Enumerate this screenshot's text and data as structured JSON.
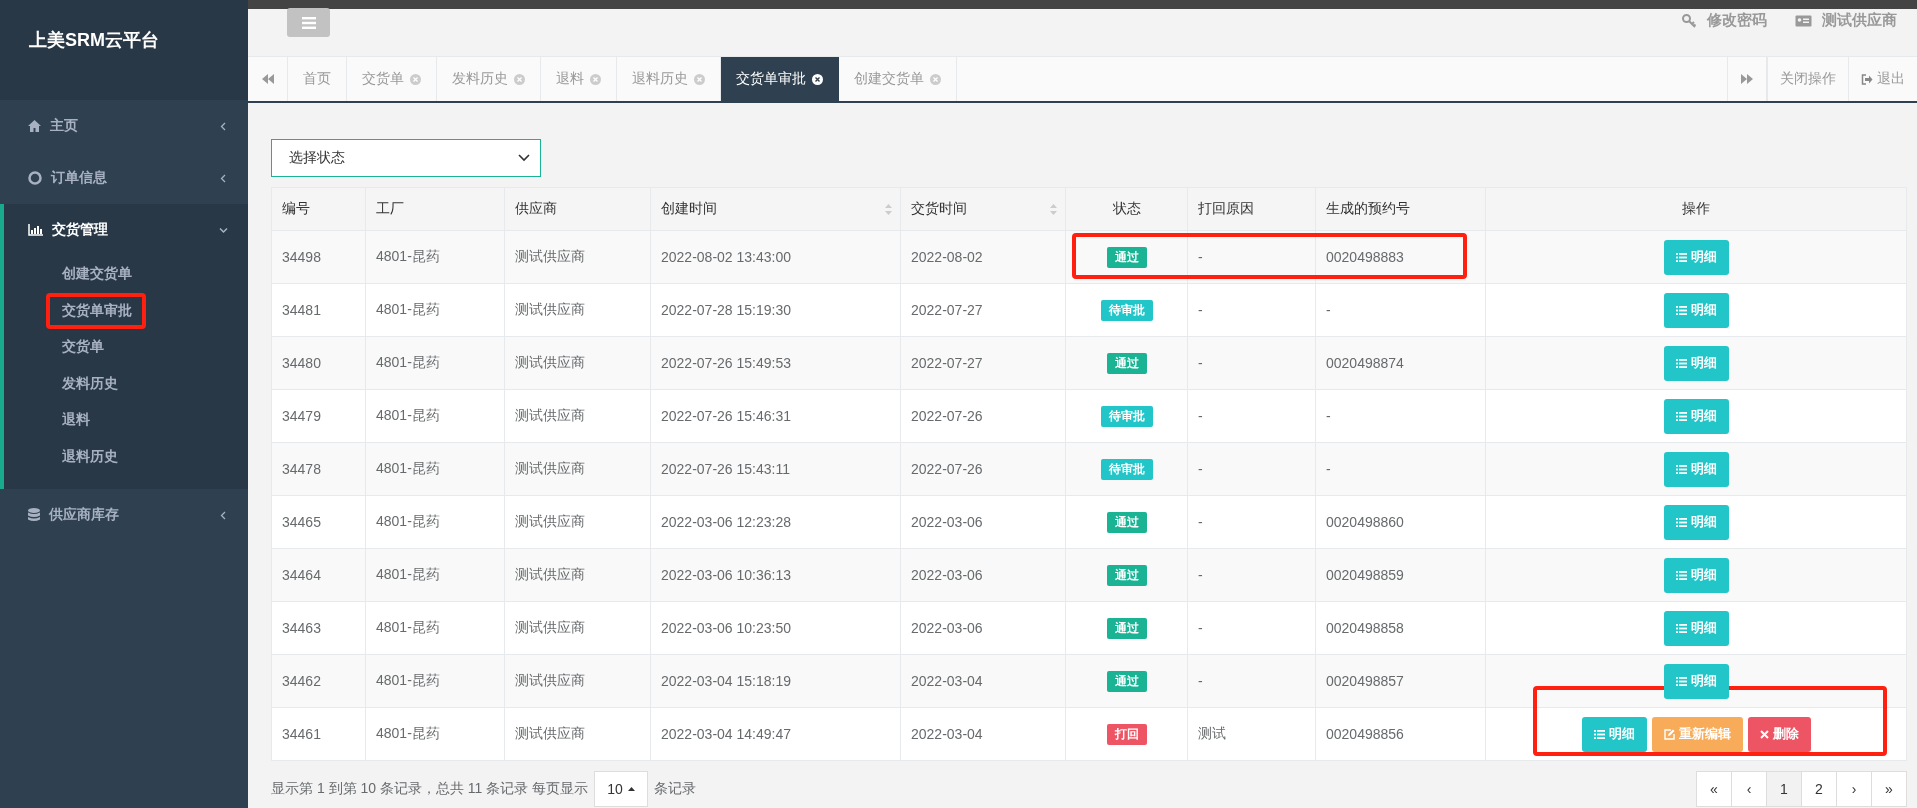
{
  "app_title": "上美SRM云平台",
  "header": {
    "links": [
      {
        "kind": "password",
        "label": "修改密码"
      },
      {
        "kind": "user",
        "label": "测试供应商"
      }
    ]
  },
  "sidebar": {
    "items": [
      {
        "label": "主页",
        "expanded": false
      },
      {
        "label": "订单信息",
        "expanded": false
      },
      {
        "label": "交货管理",
        "expanded": true,
        "children": [
          {
            "label": "创建交货单",
            "marked": false
          },
          {
            "label": "交货单审批",
            "marked": true
          },
          {
            "label": "交货单",
            "marked": false
          },
          {
            "label": "发料历史",
            "marked": false
          },
          {
            "label": "退料",
            "marked": false
          },
          {
            "label": "退料历史",
            "marked": false
          }
        ]
      },
      {
        "label": "供应商库存",
        "expanded": false
      }
    ]
  },
  "tabs": [
    {
      "label": "首页",
      "closable": false,
      "selected": false
    },
    {
      "label": "交货单",
      "closable": true,
      "selected": false
    },
    {
      "label": "发料历史",
      "closable": true,
      "selected": false
    },
    {
      "label": "退料",
      "closable": true,
      "selected": false
    },
    {
      "label": "退料历史",
      "closable": true,
      "selected": false
    },
    {
      "label": "交货单审批",
      "closable": true,
      "selected": true
    },
    {
      "label": "创建交货单",
      "closable": true,
      "selected": false
    }
  ],
  "tab_actions": {
    "close_label": "关闭操作",
    "logout_label": "退出"
  },
  "filter": {
    "placeholder": "选择状态"
  },
  "table": {
    "columns": [
      {
        "label": "编号",
        "sortable": false
      },
      {
        "label": "工厂",
        "sortable": false
      },
      {
        "label": "供应商",
        "sortable": false
      },
      {
        "label": "创建时间",
        "sortable": true
      },
      {
        "label": "交货时间",
        "sortable": true
      },
      {
        "label": "状态",
        "sortable": false
      },
      {
        "label": "打回原因",
        "sortable": false
      },
      {
        "label": "生成的预约号",
        "sortable": false
      },
      {
        "label": "操作",
        "sortable": false
      }
    ],
    "rows": [
      {
        "id": "34498",
        "plant": "4801-昆药",
        "supplier": "测试供应商",
        "created": "2022-08-02 13:43:00",
        "delivery": "2022-08-02",
        "status": {
          "kind": "approved",
          "label": "通过"
        },
        "reason": "-",
        "booking": "0020498883",
        "status_marked": true,
        "actions_marked": false,
        "actions": [
          {
            "kind": "detail",
            "label": "明细"
          }
        ]
      },
      {
        "id": "34481",
        "plant": "4801-昆药",
        "supplier": "测试供应商",
        "created": "2022-07-28 15:19:30",
        "delivery": "2022-07-27",
        "status": {
          "kind": "pending",
          "label": "待审批"
        },
        "reason": "-",
        "booking": "-",
        "status_marked": false,
        "actions_marked": false,
        "actions": [
          {
            "kind": "detail",
            "label": "明细"
          }
        ]
      },
      {
        "id": "34480",
        "plant": "4801-昆药",
        "supplier": "测试供应商",
        "created": "2022-07-26 15:49:53",
        "delivery": "2022-07-27",
        "status": {
          "kind": "approved",
          "label": "通过"
        },
        "reason": "-",
        "booking": "0020498874",
        "status_marked": false,
        "actions_marked": false,
        "actions": [
          {
            "kind": "detail",
            "label": "明细"
          }
        ]
      },
      {
        "id": "34479",
        "plant": "4801-昆药",
        "supplier": "测试供应商",
        "created": "2022-07-26 15:46:31",
        "delivery": "2022-07-26",
        "status": {
          "kind": "pending",
          "label": "待审批"
        },
        "reason": "-",
        "booking": "-",
        "status_marked": false,
        "actions_marked": false,
        "actions": [
          {
            "kind": "detail",
            "label": "明细"
          }
        ]
      },
      {
        "id": "34478",
        "plant": "4801-昆药",
        "supplier": "测试供应商",
        "created": "2022-07-26 15:43:11",
        "delivery": "2022-07-26",
        "status": {
          "kind": "pending",
          "label": "待审批"
        },
        "reason": "-",
        "booking": "-",
        "status_marked": false,
        "actions_marked": false,
        "actions": [
          {
            "kind": "detail",
            "label": "明细"
          }
        ]
      },
      {
        "id": "34465",
        "plant": "4801-昆药",
        "supplier": "测试供应商",
        "created": "2022-03-06 12:23:28",
        "delivery": "2022-03-06",
        "status": {
          "kind": "approved",
          "label": "通过"
        },
        "reason": "-",
        "booking": "0020498860",
        "status_marked": false,
        "actions_marked": false,
        "actions": [
          {
            "kind": "detail",
            "label": "明细"
          }
        ]
      },
      {
        "id": "34464",
        "plant": "4801-昆药",
        "supplier": "测试供应商",
        "created": "2022-03-06 10:36:13",
        "delivery": "2022-03-06",
        "status": {
          "kind": "approved",
          "label": "通过"
        },
        "reason": "-",
        "booking": "0020498859",
        "status_marked": false,
        "actions_marked": false,
        "actions": [
          {
            "kind": "detail",
            "label": "明细"
          }
        ]
      },
      {
        "id": "34463",
        "plant": "4801-昆药",
        "supplier": "测试供应商",
        "created": "2022-03-06 10:23:50",
        "delivery": "2022-03-06",
        "status": {
          "kind": "approved",
          "label": "通过"
        },
        "reason": "-",
        "booking": "0020498858",
        "status_marked": false,
        "actions_marked": false,
        "actions": [
          {
            "kind": "detail",
            "label": "明细"
          }
        ]
      },
      {
        "id": "34462",
        "plant": "4801-昆药",
        "supplier": "测试供应商",
        "created": "2022-03-04 15:18:19",
        "delivery": "2022-03-04",
        "status": {
          "kind": "approved",
          "label": "通过"
        },
        "reason": "-",
        "booking": "0020498857",
        "status_marked": false,
        "actions_marked": false,
        "actions": [
          {
            "kind": "detail",
            "label": "明细"
          }
        ]
      },
      {
        "id": "34461",
        "plant": "4801-昆药",
        "supplier": "测试供应商",
        "created": "2022-03-04 14:49:47",
        "delivery": "2022-03-04",
        "status": {
          "kind": "rejected",
          "label": "打回"
        },
        "reason": "测试",
        "booking": "0020498856",
        "status_marked": false,
        "actions_marked": true,
        "actions": [
          {
            "kind": "detail",
            "label": "明细"
          },
          {
            "kind": "edit",
            "label": "重新编辑"
          },
          {
            "kind": "delete",
            "label": "删除"
          }
        ]
      }
    ]
  },
  "pagination": {
    "summary_before": "显示第 1 到第 10 条记录，总共 11 条记录 每页显示",
    "page_size": "10",
    "summary_after": "条记录",
    "pages": [
      {
        "label": "«",
        "selected": false
      },
      {
        "label": "‹",
        "selected": false
      },
      {
        "label": "1",
        "selected": true
      },
      {
        "label": "2",
        "selected": false
      },
      {
        "label": "›",
        "selected": false
      },
      {
        "label": "»",
        "selected": false
      }
    ]
  }
}
